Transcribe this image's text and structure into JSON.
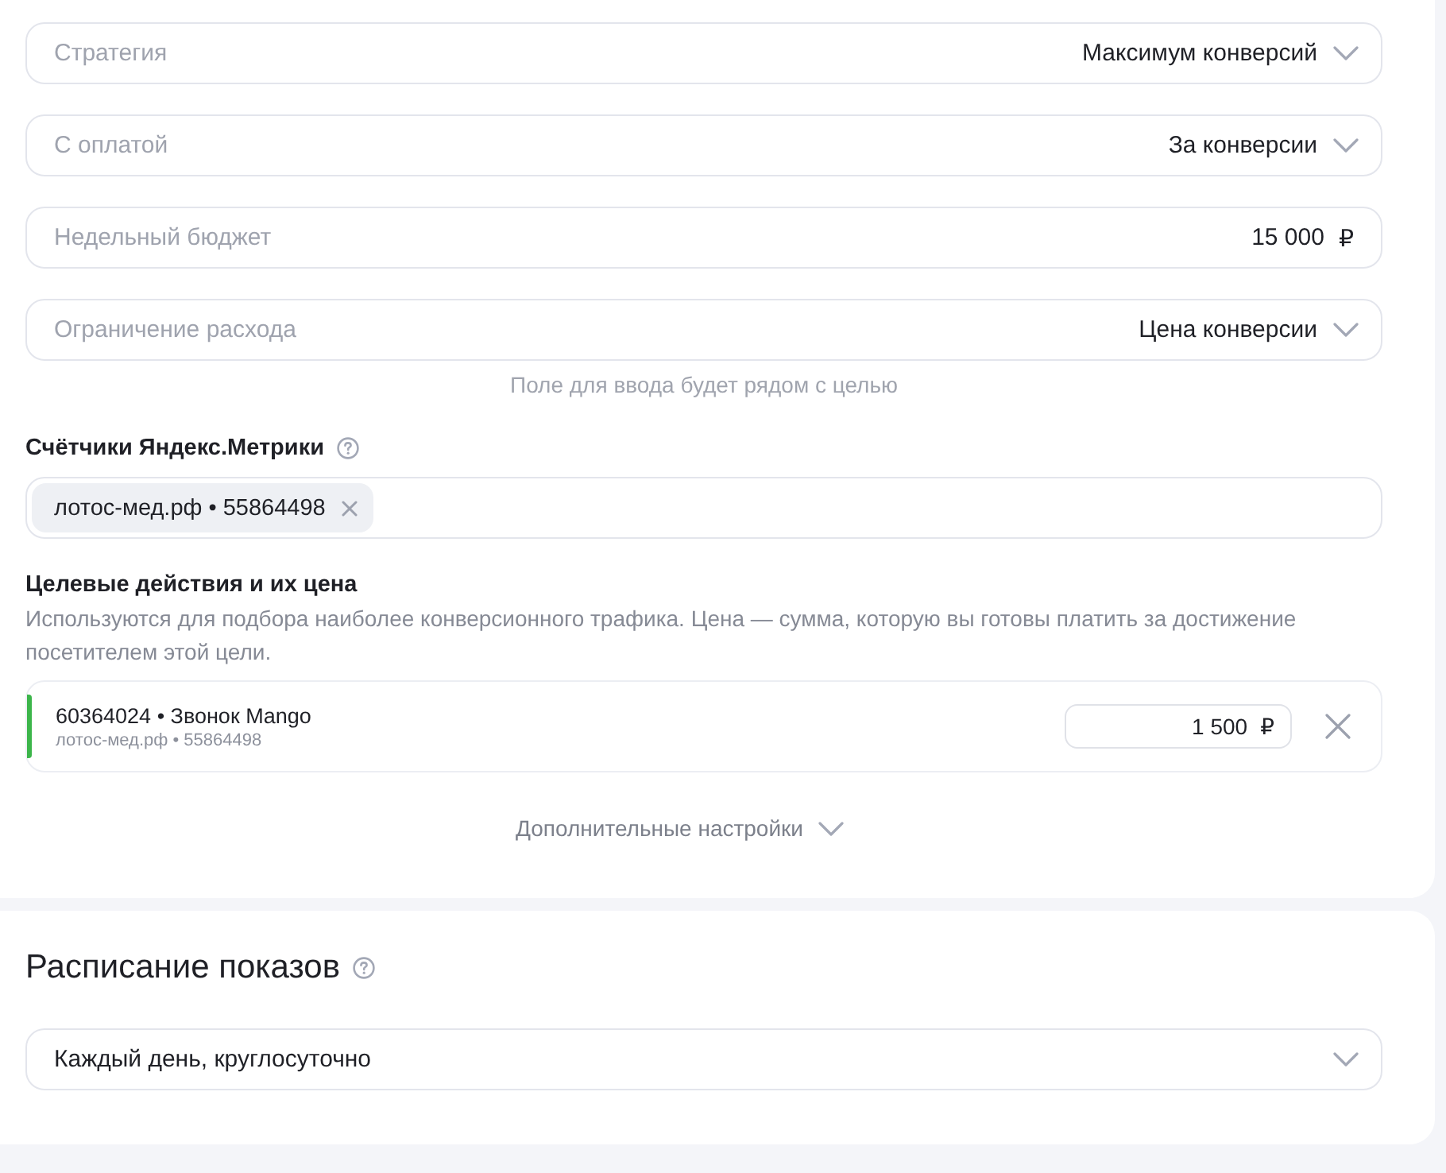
{
  "strategy_fields": [
    {
      "kind": "select",
      "label": "Стратегия",
      "value": "Максимум конверсий"
    },
    {
      "kind": "select",
      "label": "С оплатой",
      "value": "За конверсии"
    },
    {
      "kind": "amount",
      "label": "Недельный бюджет",
      "value": "15 000",
      "currency": "₽"
    },
    {
      "kind": "select",
      "label": "Ограничение расхода",
      "value": "Цена конверсии"
    }
  ],
  "field_hint": "Поле для ввода будет рядом с целью",
  "metrika_counters": {
    "label": "Счётчики Яндекс.Метрики",
    "chips": [
      {
        "text": "лотос-мед.рф • 55864498"
      }
    ]
  },
  "goals": {
    "title": "Целевые действия и их цена",
    "description": "Используются для подбора наиболее конверсионного трафика. Цена — сумма, которую вы готовы платить за достижение посетителем этой цели.",
    "items": [
      {
        "title": "60364024 • Звонок Mango",
        "subtitle": "лотос-мед.рф • 55864498",
        "price": "1 500",
        "currency": "₽",
        "color": "#3cb54a"
      }
    ]
  },
  "more_settings": {
    "label": "Дополнительные настройки",
    "expanded": false
  },
  "schedule": {
    "title": "Расписание показов",
    "value": "Каждый день, круглосуточно"
  }
}
